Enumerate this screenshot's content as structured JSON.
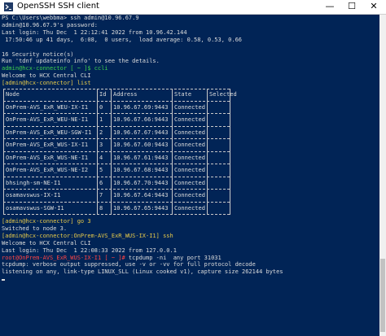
{
  "window": {
    "title": "OpenSSH SSH client",
    "controls": {
      "minimize": "—",
      "maximize": "☐",
      "close": "✕"
    }
  },
  "console": {
    "lines": [
      {
        "text": "PS C:\\Users\\webbma> ssh admin@10.96.67.9",
        "color": "#dcdcdc"
      },
      {
        "text": "admin@10.96.67.9's password:",
        "color": "#dcdcdc"
      },
      {
        "text": "Last login: Thu Dec  1 22:12:41 2022 from 10.96.42.144",
        "color": "#dcdcdc"
      },
      {
        "text": " 17:50:46 up 41 days,  6:08,  0 users,  load average: 0.58, 0.53, 0.66",
        "color": "#dcdcdc"
      },
      {
        "text": "",
        "color": "#dcdcdc"
      },
      {
        "text": "16 Security notice(s)",
        "color": "#dcdcdc"
      },
      {
        "text": "Run 'tdnf updateinfo info' to see the details.",
        "color": "#dcdcdc"
      },
      {
        "text": "admin@hcx-connector [ ~ ]$ ccli",
        "color": "#3fd14c"
      },
      {
        "text": "Welcome to HCX Central CLI",
        "color": "#dcdcdc"
      },
      {
        "text": "[admin@hcx-connector] list",
        "color": "#e6c84a"
      }
    ],
    "table": {
      "headers": [
        "Node",
        "Id",
        "Address",
        "State",
        "Selected"
      ],
      "rows": [
        [
          "OnPrem-AVS_ExR_WEU-IX-I1",
          "0",
          "10.96.67.69:9443",
          "Connected",
          ""
        ],
        [
          "OnPrem-AVS_ExR_WEU-NE-I1",
          "1",
          "10.96.67.66:9443",
          "Connected",
          ""
        ],
        [
          "OnPrem-AVS_ExR_WEU-SGW-I1",
          "2",
          "10.96.67.67:9443",
          "Connected",
          ""
        ],
        [
          "OnPrem-AVS_ExR_WUS-IX-I1",
          "3",
          "10.96.67.60:9443",
          "Connected",
          ""
        ],
        [
          "OnPrem-AVS_ExR_WUS-NE-I1",
          "4",
          "10.96.67.61:9443",
          "Connected",
          ""
        ],
        [
          "OnPrem-AVS_ExR_WUS-NE-I2",
          "5",
          "10.96.67.68:9443",
          "Connected",
          ""
        ],
        [
          "bhsingh-sm-NE-I1",
          "6",
          "10.96.67.70:9443",
          "Connected",
          ""
        ],
        [
          "osamavswus-IX-I1",
          "7",
          "10.96.67.64:9443",
          "Connected",
          ""
        ],
        [
          "osamavswus-SGW-I1",
          "8",
          "10.96.67.65:9443",
          "Connected",
          ""
        ]
      ]
    },
    "after": [
      {
        "text": "[admin@hcx-connector] go 3",
        "color": "#e6c84a"
      },
      {
        "text": "Switched to node 3.",
        "color": "#dcdcdc"
      },
      {
        "text": "[admin@hcx-connector:OnPrem-AVS_ExR_WUS-IX-I1] ssh",
        "color": "#e6c84a"
      },
      {
        "text": "Welcome to HCX Central CLI",
        "color": "#dcdcdc"
      },
      {
        "text": "Last login: Thu Dec  1 22:08:33 2022 from 127.0.0.1",
        "color": "#dcdcdc"
      },
      {
        "text": "root@OnPrem-AVS_ExR_WUS-IX-I1 [ ~ ]# tcpdump -ni  any port 31031",
        "color": "#dcdcdc",
        "prompt": "root@OnPrem-AVS_ExR_WUS-IX-I1 [ ~ ]#",
        "rest": " tcpdump -ni  any port 31031"
      },
      {
        "text": "tcpdump: verbose output suppressed, use -v or -vv for full protocol decode",
        "color": "#dcdcdc"
      },
      {
        "text": "listening on any, link-type LINUX_SLL (Linux cooked v1), capture size 262144 bytes",
        "color": "#dcdcdc"
      }
    ]
  }
}
